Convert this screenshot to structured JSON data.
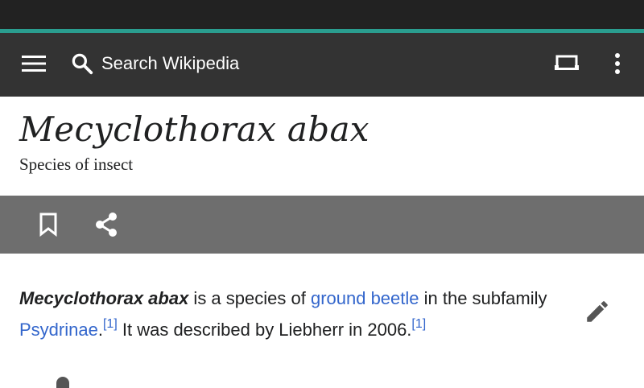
{
  "toolbar": {
    "menu_icon": "hamburger-menu-icon",
    "search_icon": "search-icon",
    "search_placeholder": "Search Wikipedia",
    "tabs_icon": "tabs-icon",
    "overflow_icon": "more-vert-icon"
  },
  "article": {
    "title": "Mecyclothorax abax",
    "description": "Species of insect"
  },
  "actions": {
    "bookmark_icon": "bookmark-icon",
    "share_icon": "share-icon"
  },
  "content": {
    "lead_bold": "Mecyclothorax abax",
    "text_1": " is a species of ",
    "link_ground_beetle": "ground beetle",
    "text_2": " in the subfamily ",
    "link_psydrinae": "Psydrinae",
    "text_3": ".",
    "ref_1": "[1]",
    "text_4": " It was described by Liebherr in 2006.",
    "ref_2": "[1]",
    "edit_icon": "edit-pencil-icon"
  },
  "colors": {
    "app_bar": "#333333",
    "status_bar": "#222222",
    "accent": "#2a9d8f",
    "action_bar": "#6e6e6e",
    "link": "#3366cc",
    "text": "#202122"
  }
}
